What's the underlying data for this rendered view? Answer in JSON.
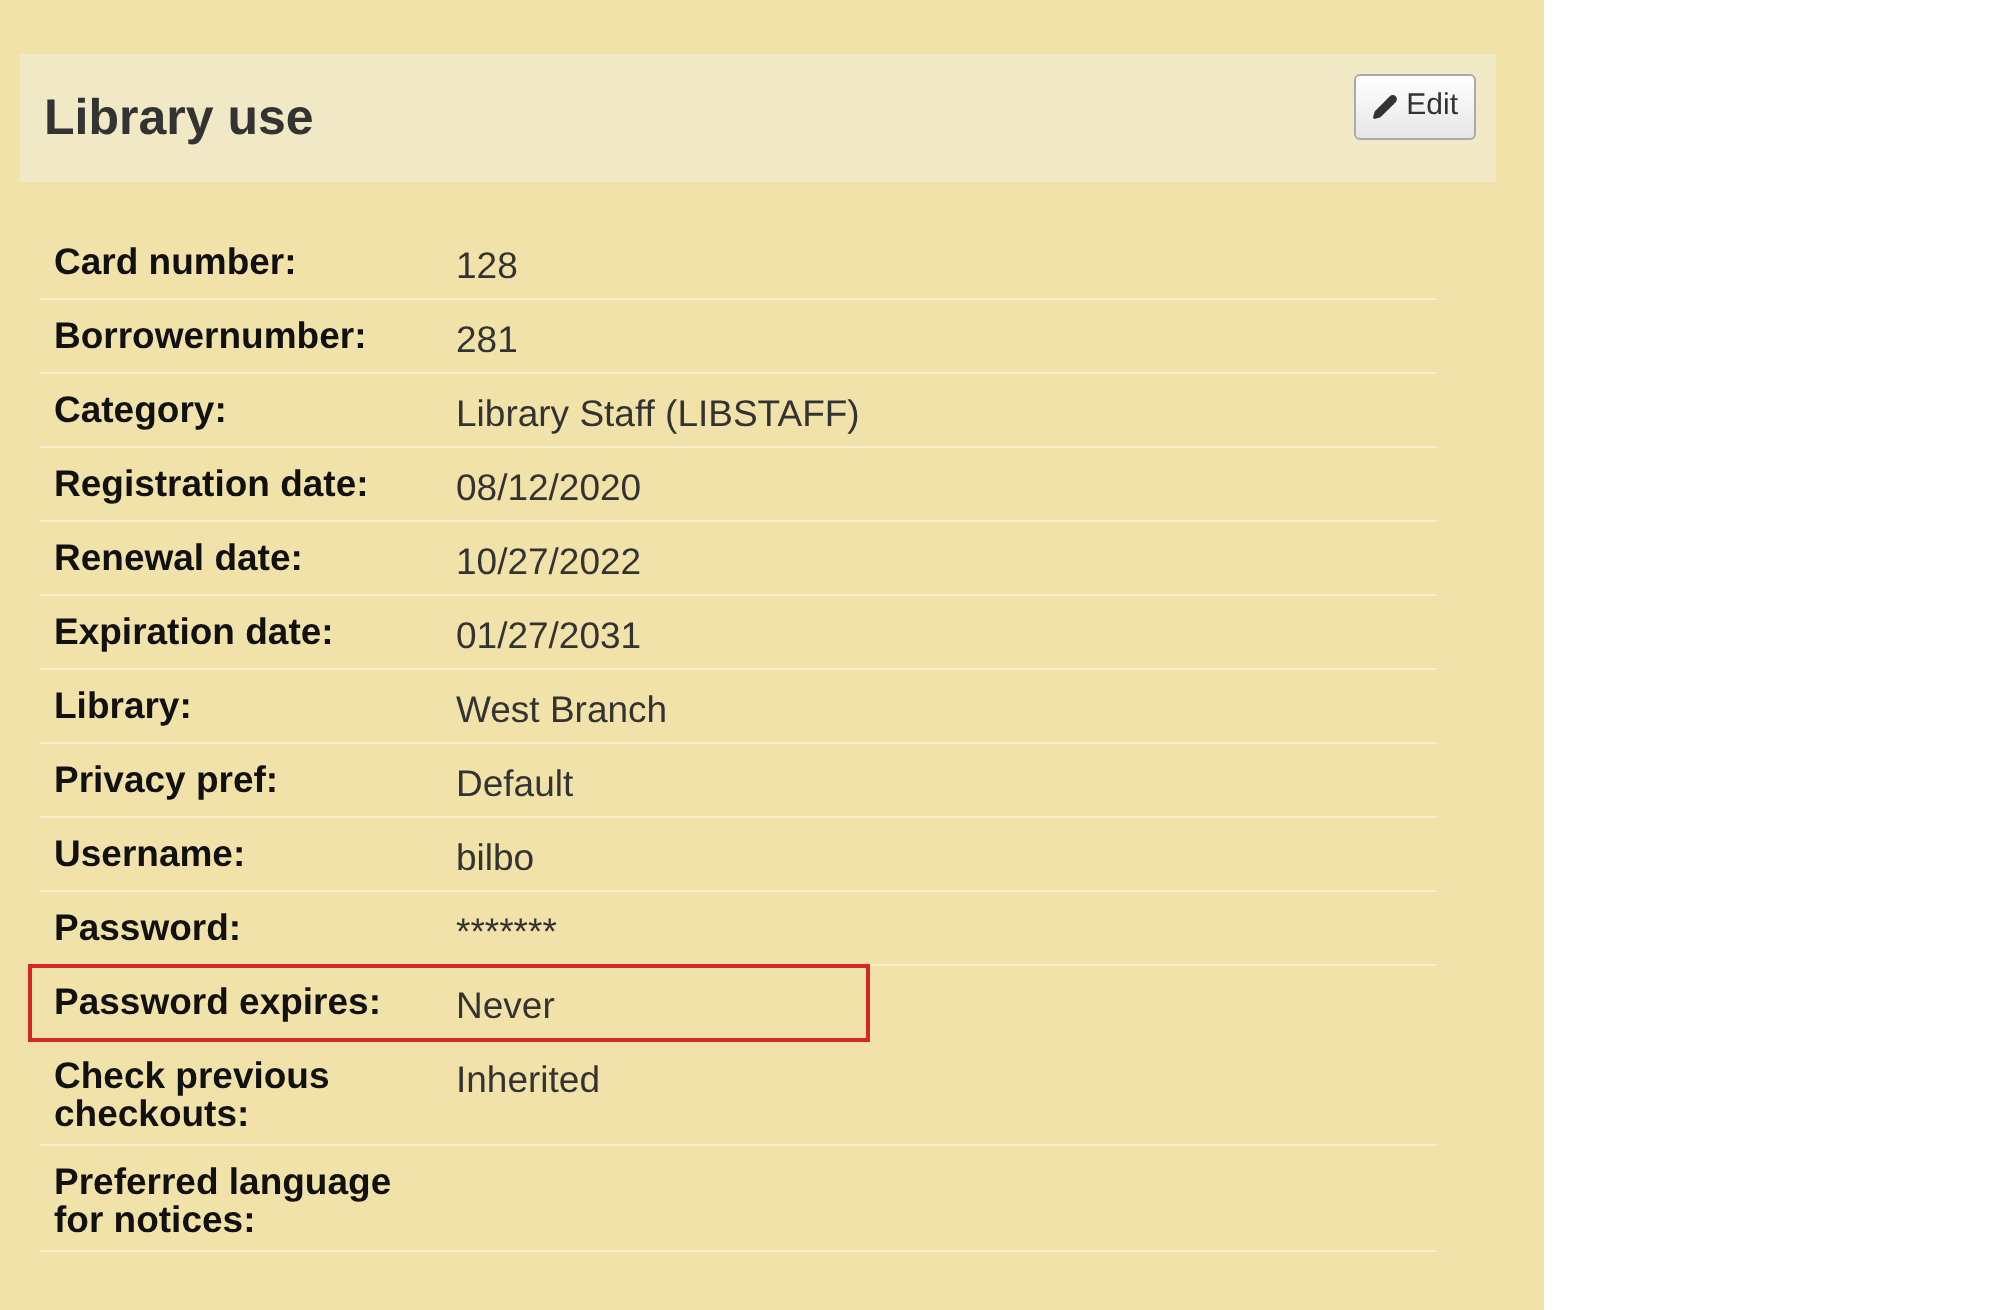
{
  "panel": {
    "title": "Library use",
    "edit_button": "Edit"
  },
  "rows": [
    {
      "label": "Card number:",
      "value": "128",
      "highlighted": false
    },
    {
      "label": "Borrowernumber:",
      "value": "281",
      "highlighted": false
    },
    {
      "label": "Category:",
      "value": "Library Staff (LIBSTAFF)",
      "highlighted": false
    },
    {
      "label": "Registration date:",
      "value": "08/12/2020",
      "highlighted": false
    },
    {
      "label": "Renewal date:",
      "value": "10/27/2022",
      "highlighted": false
    },
    {
      "label": "Expiration date:",
      "value": "01/27/2031",
      "highlighted": false
    },
    {
      "label": "Library:",
      "value": "West Branch",
      "highlighted": false
    },
    {
      "label": "Privacy pref:",
      "value": "Default",
      "highlighted": false
    },
    {
      "label": "Username:",
      "value": "bilbo",
      "highlighted": false
    },
    {
      "label": "Password:",
      "value": "*******",
      "highlighted": false
    },
    {
      "label": "Password expires:",
      "value": "Never",
      "highlighted": true
    },
    {
      "label": "Check previous checkouts:",
      "value": "Inherited",
      "highlighted": false
    },
    {
      "label": "Preferred language for notices:",
      "highlighted": false
    }
  ]
}
